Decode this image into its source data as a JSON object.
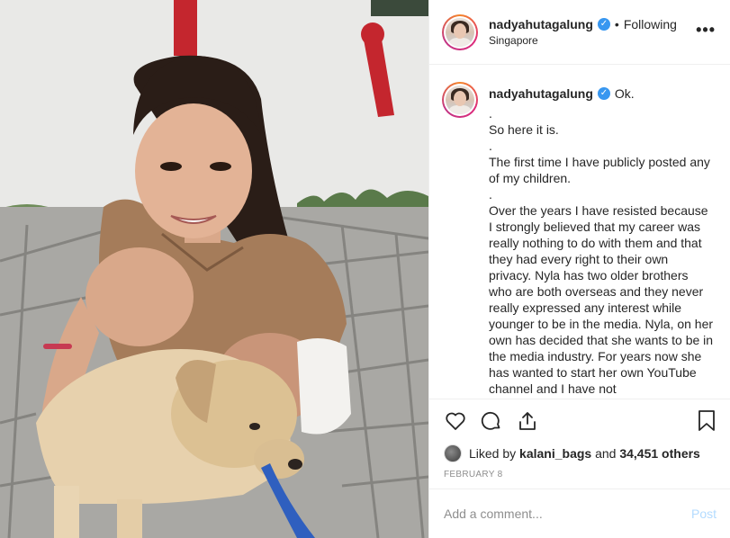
{
  "post": {
    "username": "nadyahutagalung",
    "following_label": "Following",
    "separator": "•",
    "location": "Singapore",
    "more_label": "•••"
  },
  "caption": {
    "username": "nadyahutagalung",
    "first_line": "Ok.",
    "lines": [
      ".",
      "So here it is.",
      ".",
      "The first time I have publicly posted any of my children.",
      ".",
      "Over the years I have resisted because I strongly believed that my career was really nothing to do with them and that they had every right to their own privacy. Nyla has two older brothers who are both overseas and they never really expressed any interest while younger to be in the media. Nyla, on her own has decided that she wants to be in the media industry. For years now she has wanted to start her own YouTube channel and I have not"
    ]
  },
  "actions": {
    "like_icon": "heart-icon",
    "comment_icon": "comment-icon",
    "share_icon": "share-icon",
    "save_icon": "bookmark-icon"
  },
  "likes": {
    "prefix": "Liked by",
    "liker": "kalani_bags",
    "middle": "and",
    "others": "34,451 others"
  },
  "date": "February 8",
  "comment": {
    "placeholder": "Add a comment...",
    "post_label": "Post"
  },
  "colors": {
    "verified": "#3897f0",
    "post_disabled": "#b3dbff",
    "muted": "#8e8e8e",
    "text": "#262626"
  }
}
